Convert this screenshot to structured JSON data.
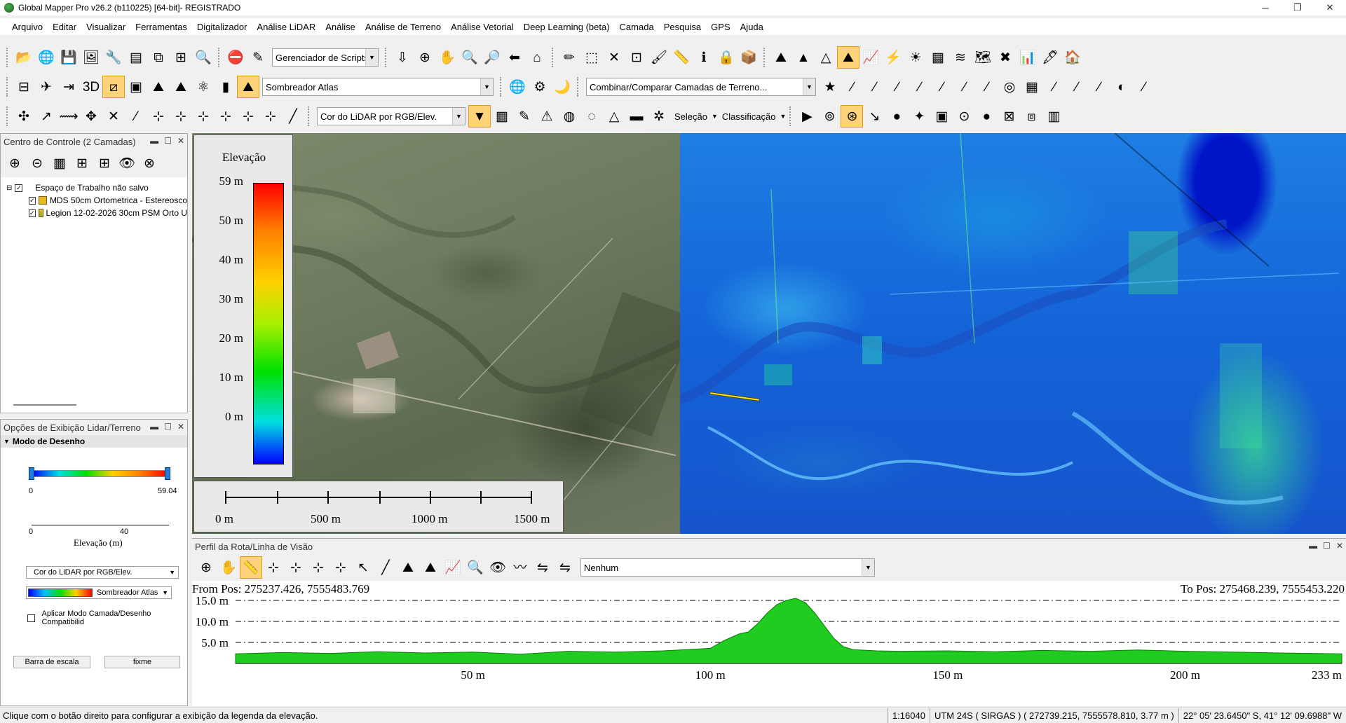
{
  "window": {
    "title": "Global Mapper Pro v26.2 (b110225) [64-bit]- REGISTRADO",
    "minimize": "─",
    "maximize": "❐",
    "close": "✕"
  },
  "menu": [
    "Arquivo",
    "Editar",
    "Visualizar",
    "Ferramentas",
    "Digitalizador",
    "Análise LiDAR",
    "Análise",
    "Análise de Terreno",
    "Análise Vetorial",
    "Deep Learning (beta)",
    "Camada",
    "Pesquisa",
    "GPS",
    "Ajuda"
  ],
  "toolbar1": {
    "icons_a": [
      "📂",
      "🌐",
      "💾",
      "🖼",
      "🔧",
      "▤",
      "⧉",
      "⊞",
      "🔍"
    ],
    "icons_b": [
      "⛔",
      "✎"
    ],
    "script_dropdown": "Gerenciador de Scripts Fav",
    "icons_c": [
      "⇩",
      "⊕",
      "✋",
      "🔍",
      "🔎",
      "⬅",
      "⌂"
    ],
    "icons_d": [
      "✏",
      "⬚",
      "✕",
      "⊡",
      "🖌",
      "📏",
      "ℹ",
      "🔒",
      "📦"
    ],
    "icons_e": [
      "⛰",
      "▲",
      "△",
      "⛰",
      "📈",
      "⚡",
      "☀",
      "▦",
      "≋",
      "🗺",
      "✖",
      "📊",
      "🖋",
      "🏠"
    ]
  },
  "toolbar2": {
    "icons_a": [
      "⊟",
      "✈",
      "⇥",
      "3D",
      "⧄",
      "▣",
      "⛰",
      "⛰",
      "⚛",
      "▮",
      "⛰"
    ],
    "shader_dropdown": "Sombreador Atlas",
    "icons_b": [
      "🌐",
      "⚙",
      "🌙"
    ],
    "combine_dropdown": "Combinar/Comparar Camadas de Terreno...",
    "icons_c": [
      "★",
      "∕",
      "∕",
      "∕",
      "∕",
      "∕",
      "∕",
      "∕",
      "◎",
      "▦",
      "∕",
      "∕",
      "∕",
      "◐",
      "∕"
    ]
  },
  "toolbar3": {
    "icons_a": [
      "✣",
      "↗",
      "⟿",
      "✥",
      "✕",
      "⁄",
      "⊹",
      "⊹",
      "⊹",
      "⊹",
      "⊹",
      "⊹",
      "╱"
    ],
    "lidar_dropdown": "Cor do LiDAR por RGB/Elev.",
    "icons_b": [
      "▼",
      "▦",
      "✎",
      "⚠",
      "◍",
      "◌",
      "△",
      "▬",
      "✲"
    ],
    "selecao_label": "Seleção",
    "classificacao_label": "Classificação",
    "icons_c": [
      "▶",
      "⊚",
      "⊛",
      "↘",
      "●",
      "✦",
      "▣",
      "⊙",
      "●",
      "⊠",
      "⧈",
      "▥"
    ]
  },
  "control_center": {
    "title": "Centro de Controle (2 Camadas)",
    "tool_icons": [
      "⊕",
      "⊝",
      "▦",
      "⊞",
      "⊞",
      "👁",
      "⊗"
    ],
    "workspace": "Espaço de Trabalho não salvo",
    "layers": [
      "MDS 50cm Ortometrica - Estereosco",
      "Legion 12-02-2026 30cm PSM Orto U"
    ]
  },
  "lidar_options": {
    "title": "Opções de Exibição Lidar/Terreno",
    "section": "Modo de Desenho",
    "range_min": "0",
    "range_max": "59.04",
    "axis_min": "0",
    "axis_mid": "40",
    "axis_label": "Elevação (m)",
    "color_mode": "Cor do LiDAR por RGB/Elev.",
    "shader": "Sombreador Atlas",
    "apply_label": "Aplicar Modo Camada/Desenho Compatibilid",
    "scale_button": "Barra de escala",
    "fixme_button": "fixme"
  },
  "map": {
    "legend_title": "Elevação",
    "legend_ticks": [
      "59 m",
      "50 m",
      "40 m",
      "30 m",
      "20 m",
      "10 m",
      "0 m"
    ],
    "scale_labels": [
      "0 m",
      "500 m",
      "1000 m",
      "1500 m"
    ]
  },
  "profile": {
    "title": "Perfil da Rota/Linha de Visão",
    "tool_icons": [
      "⊕",
      "✋",
      "📏",
      "⊹",
      "⊹",
      "⊹",
      "⊹",
      "↖",
      "╱",
      "⛰",
      "⛰",
      "📈",
      "🔍",
      "👁",
      "〰",
      "⇋",
      "⇋"
    ],
    "dropdown": "Nenhum",
    "from_pos": "From Pos: 275237.426, 7555483.769",
    "to_pos": "To Pos: 275468.239, 7555453.220"
  },
  "chart_data": {
    "type": "area",
    "title": "",
    "xlabel": "",
    "ylabel": "",
    "xlim": [
      0,
      233
    ],
    "ylim": [
      0,
      16
    ],
    "y_ticks": [
      "15.0 m",
      "10.0 m",
      "5.0 m"
    ],
    "y_tick_values": [
      15,
      10,
      5
    ],
    "x_ticks": [
      "50 m",
      "100 m",
      "150 m",
      "200 m",
      "233 m"
    ],
    "x_tick_values": [
      50,
      100,
      150,
      200,
      233
    ],
    "grid": true,
    "fill_color": "#1fcc1f",
    "series": [
      {
        "x": [
          0,
          10,
          20,
          30,
          40,
          50,
          60,
          70,
          80,
          90,
          95,
          100,
          103,
          106,
          108,
          110,
          112,
          114,
          116,
          118,
          120,
          122,
          124,
          126,
          128,
          130,
          135,
          140,
          150,
          160,
          170,
          180,
          190,
          200,
          210,
          220,
          233
        ],
        "y": [
          2.3,
          2.6,
          2.4,
          2.8,
          2.5,
          2.7,
          2.2,
          2.9,
          2.7,
          3.0,
          3.3,
          3.6,
          5.5,
          7.0,
          7.5,
          9.5,
          12.0,
          14.0,
          15.0,
          15.5,
          14.5,
          12.0,
          9.0,
          6.0,
          4.0,
          3.3,
          3.0,
          2.9,
          3.0,
          2.8,
          3.1,
          2.9,
          3.2,
          2.9,
          2.7,
          2.5,
          2.3
        ]
      }
    ]
  },
  "status": {
    "hint": "Clique com o botão direito para configurar a exibição da legenda da elevação.",
    "scale": "1:16040",
    "coords": "UTM 24S ( SIRGAS ) ( 272739.215, 7555578.810, 3.77 m )",
    "latlon": "22° 05' 23.6450\" S, 41° 12' 09.6988\" W"
  },
  "colors": {
    "accent": "#ffd37a",
    "lidar_blue": "#1e7ee2",
    "ortho_green": "#6c7a5e"
  }
}
